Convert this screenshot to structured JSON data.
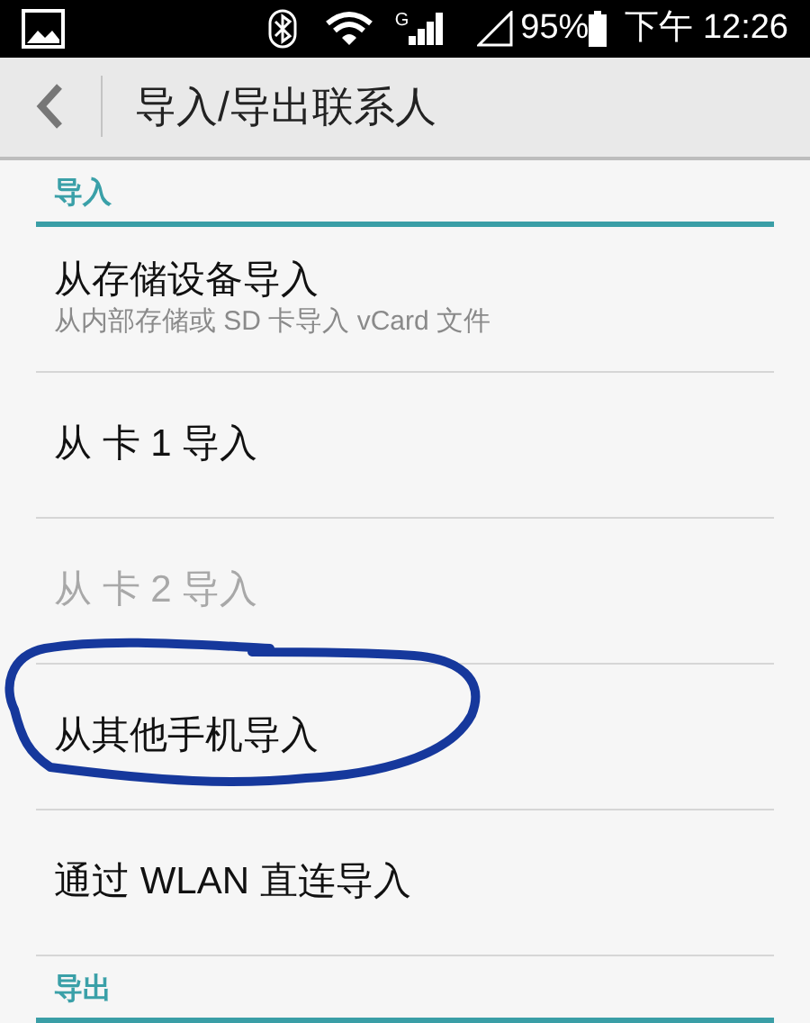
{
  "status_bar": {
    "network_type": "G",
    "battery": "95%",
    "time": "下午 12:26"
  },
  "toolbar": {
    "title": "导入/导出联系人"
  },
  "sections": [
    {
      "title": "导入",
      "items": [
        {
          "title": "从存储设备导入",
          "subtitle": "从内部存储或 SD 卡导入 vCard 文件",
          "disabled": false,
          "circled": false
        },
        {
          "title": "从 卡 1 导入",
          "disabled": false,
          "circled": false
        },
        {
          "title": "从 卡 2 导入",
          "disabled": true,
          "circled": false
        },
        {
          "title": "从其他手机导入",
          "disabled": false,
          "circled": true
        },
        {
          "title": "通过 WLAN 直连导入",
          "disabled": false,
          "circled": false
        }
      ]
    },
    {
      "title": "导出"
    }
  ]
}
